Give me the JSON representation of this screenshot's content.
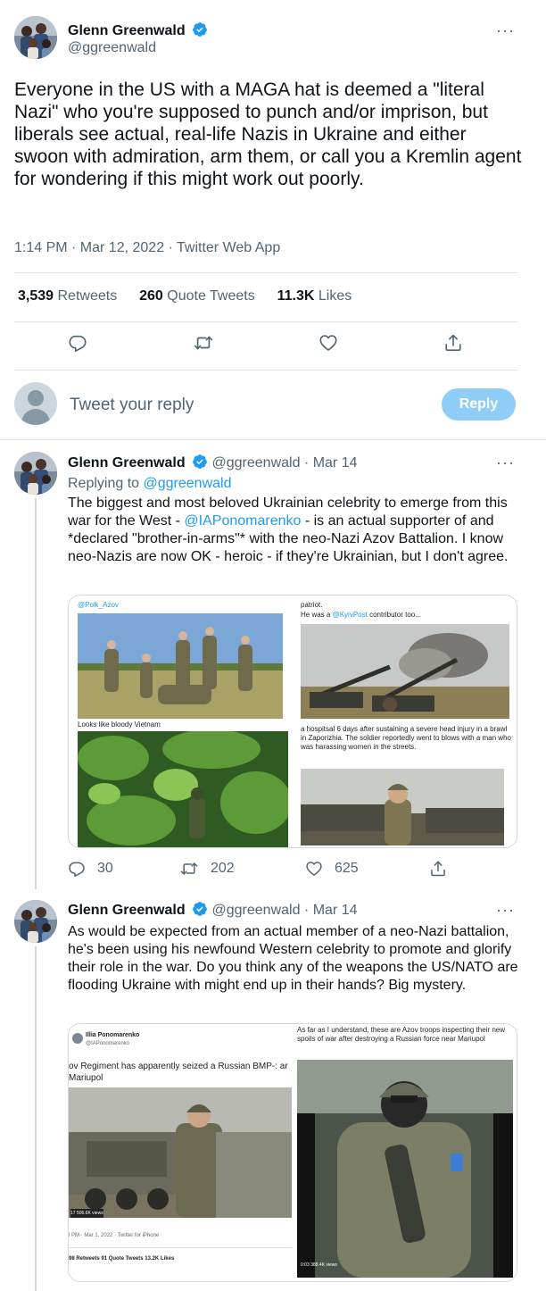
{
  "main_tweet": {
    "author_name": "Glenn Greenwald",
    "author_handle": "@ggreenwald",
    "more": "···",
    "text": "Everyone in the US with a MAGA hat is deemed a \"literal Nazi\" who you're supposed to punch and/or imprison, but liberals see actual, real-life Nazis in Ukraine and either swoon with admiration, arm them, or call you a Kremlin agent for wondering if this might work out poorly.",
    "meta": "1:14 PM · Mar 12, 2022 · Twitter Web App",
    "retweets_count": "3,539",
    "retweets_label": "Retweets",
    "quotes_count": "260",
    "quotes_label": "Quote Tweets",
    "likes_count": "11.3K",
    "likes_label": "Likes"
  },
  "composer": {
    "placeholder": "Tweet your reply",
    "reply_label": "Reply"
  },
  "reply1": {
    "author_name": "Glenn Greenwald",
    "author_handle": "@ggreenwald",
    "date": "· Mar 14",
    "more": "···",
    "replying_prefix": "Replying to",
    "replying_handle": "@ggreenwald",
    "text_part1": "The biggest and most beloved Ukrainian celebrity to emerge from this war for the West - ",
    "mention": "@IAPonomarenko",
    "text_part2": " - is an actual supporter of and *declared \"brother-in-arms\"* with the neo-Nazi Azov Battalion. I know neo-Nazis are now OK - heroic - if they're Ukrainian, but I don't agree.",
    "media": {
      "caption_handle": "@Polk_Azov",
      "caption_patriot": "patriot.",
      "caption_contrib_prefix": "He was a",
      "caption_contrib_handle": "@KyivPost",
      "caption_contrib_suffix": "contributor too...",
      "caption_vietnam": "Looks like bloody Vietnam",
      "caption_hospital": "a hospitsal 6 days after sustaining a severe head injury in a brawl in Zaporizhia. The soldier reportedly went to blows with a man who was harassing women in the streets."
    },
    "replies_count": "30",
    "retweets_count": "202",
    "likes_count": "625"
  },
  "reply2": {
    "author_name": "Glenn Greenwald",
    "author_handle": "@ggreenwald",
    "date": "· Mar 14",
    "more": "···",
    "text": "As would be expected from an actual member of a neo-Nazi battalion, he's been using his newfound Western celebrity to promote and glorify their role in the war. Do you think any of the weapons the US/NATO are flooding Ukraine with might end up in their hands? Big mystery.",
    "media": {
      "embed_name": "Illia Ponomarenko",
      "embed_handle": "@IAPonomarenko",
      "embed_text": "ov Regiment has apparently seized a Russian BMP-: ar Mariupol",
      "embed_views": "17  506.6K views",
      "embed_meta": "l PM · Mar 1, 2022 · Twitter for iPhone",
      "embed_stats": "98 Retweets     91 Quote Tweets     13.2K Likes",
      "right_caption": "As far as I understand, these are Azov troops inspecting their new spoils of war after destroying a Russian force near Mariupol",
      "right_views": "0:03  388.4K views"
    }
  },
  "colors": {
    "accent": "#1d9bf0",
    "text": "#0f1419",
    "muted": "#536471",
    "divider": "#dfe3e6",
    "reply_button": "#8ecdf8"
  },
  "icons": [
    "verified-badge-icon",
    "more-icon",
    "reply-icon",
    "retweet-icon",
    "like-icon",
    "share-icon",
    "default-avatar-icon"
  ]
}
